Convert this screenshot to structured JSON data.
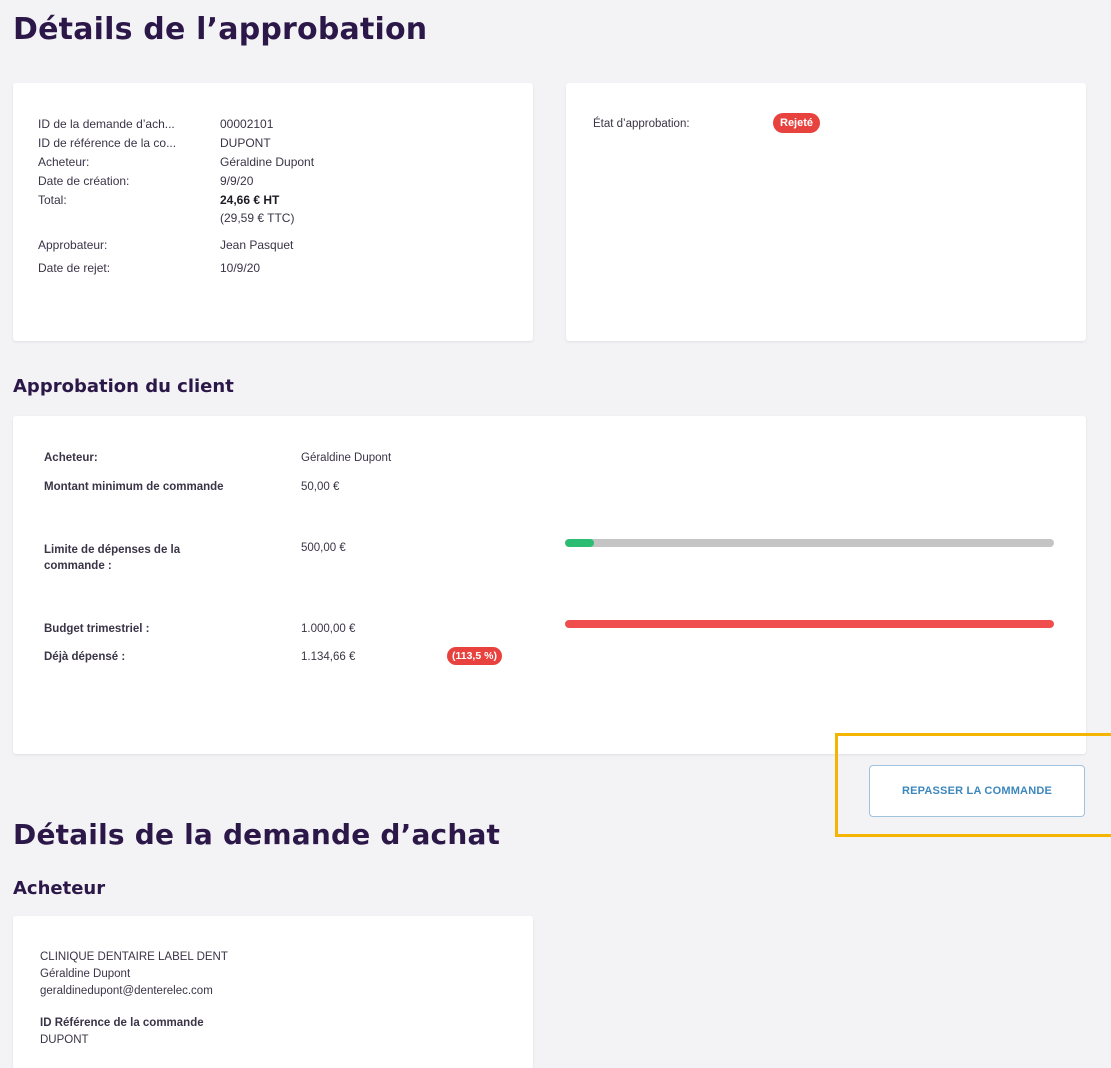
{
  "page_title": "Détails de l’approbation",
  "approval_details": {
    "rows": [
      {
        "label": "ID de la demande d’ach...",
        "value": "00002101"
      },
      {
        "label": "ID de référence de la co...",
        "value": "DUPONT"
      },
      {
        "label": "Acheteur:",
        "value": "Géraldine Dupont"
      },
      {
        "label": "Date de création:",
        "value": "9/9/20"
      },
      {
        "label": "Total:",
        "value": "24,66 € HT",
        "value2": "(29,59 € TTC)"
      },
      {
        "label": "Approbateur:",
        "value": "Jean Pasquet"
      },
      {
        "label": "Date de rejet:",
        "value": "10/9/20"
      }
    ]
  },
  "approval_status": {
    "label": "État d’approbation:",
    "status": "Rejeté",
    "status_color": "#e8423f"
  },
  "client_section": {
    "title": "Approbation du client",
    "buyer_label": "Acheteur:",
    "buyer_value": "Géraldine Dupont",
    "min_order_label": "Montant minimum de commande",
    "min_order_value": "50,00 €",
    "order_limit_label": "Limite de dépenses de la commande :",
    "order_limit_value": "500,00 €",
    "order_limit_progress": 0.06,
    "order_limit_color": "#2dbd72",
    "quarterly_budget_label": "Budget trimestriel :",
    "quarterly_budget_value": "1.000,00 €",
    "already_spent_label": "Déjà dépensé :",
    "already_spent_value": "1.134,66 €",
    "already_spent_pct": "(113,5 %)",
    "budget_progress": 1.0,
    "budget_color": "#f04e4e"
  },
  "reorder_button": "REPASSER LA COMMANDE",
  "purchase_request": {
    "title": "Détails de la demande d’achat",
    "buyer_heading": "Acheteur",
    "company": "CLINIQUE DENTAIRE LABEL DENT",
    "name": "Géraldine Dupont",
    "email": "geraldinedupont@denterelec.com",
    "ref_label": "ID Référence de la commande",
    "ref_value": "DUPONT"
  }
}
